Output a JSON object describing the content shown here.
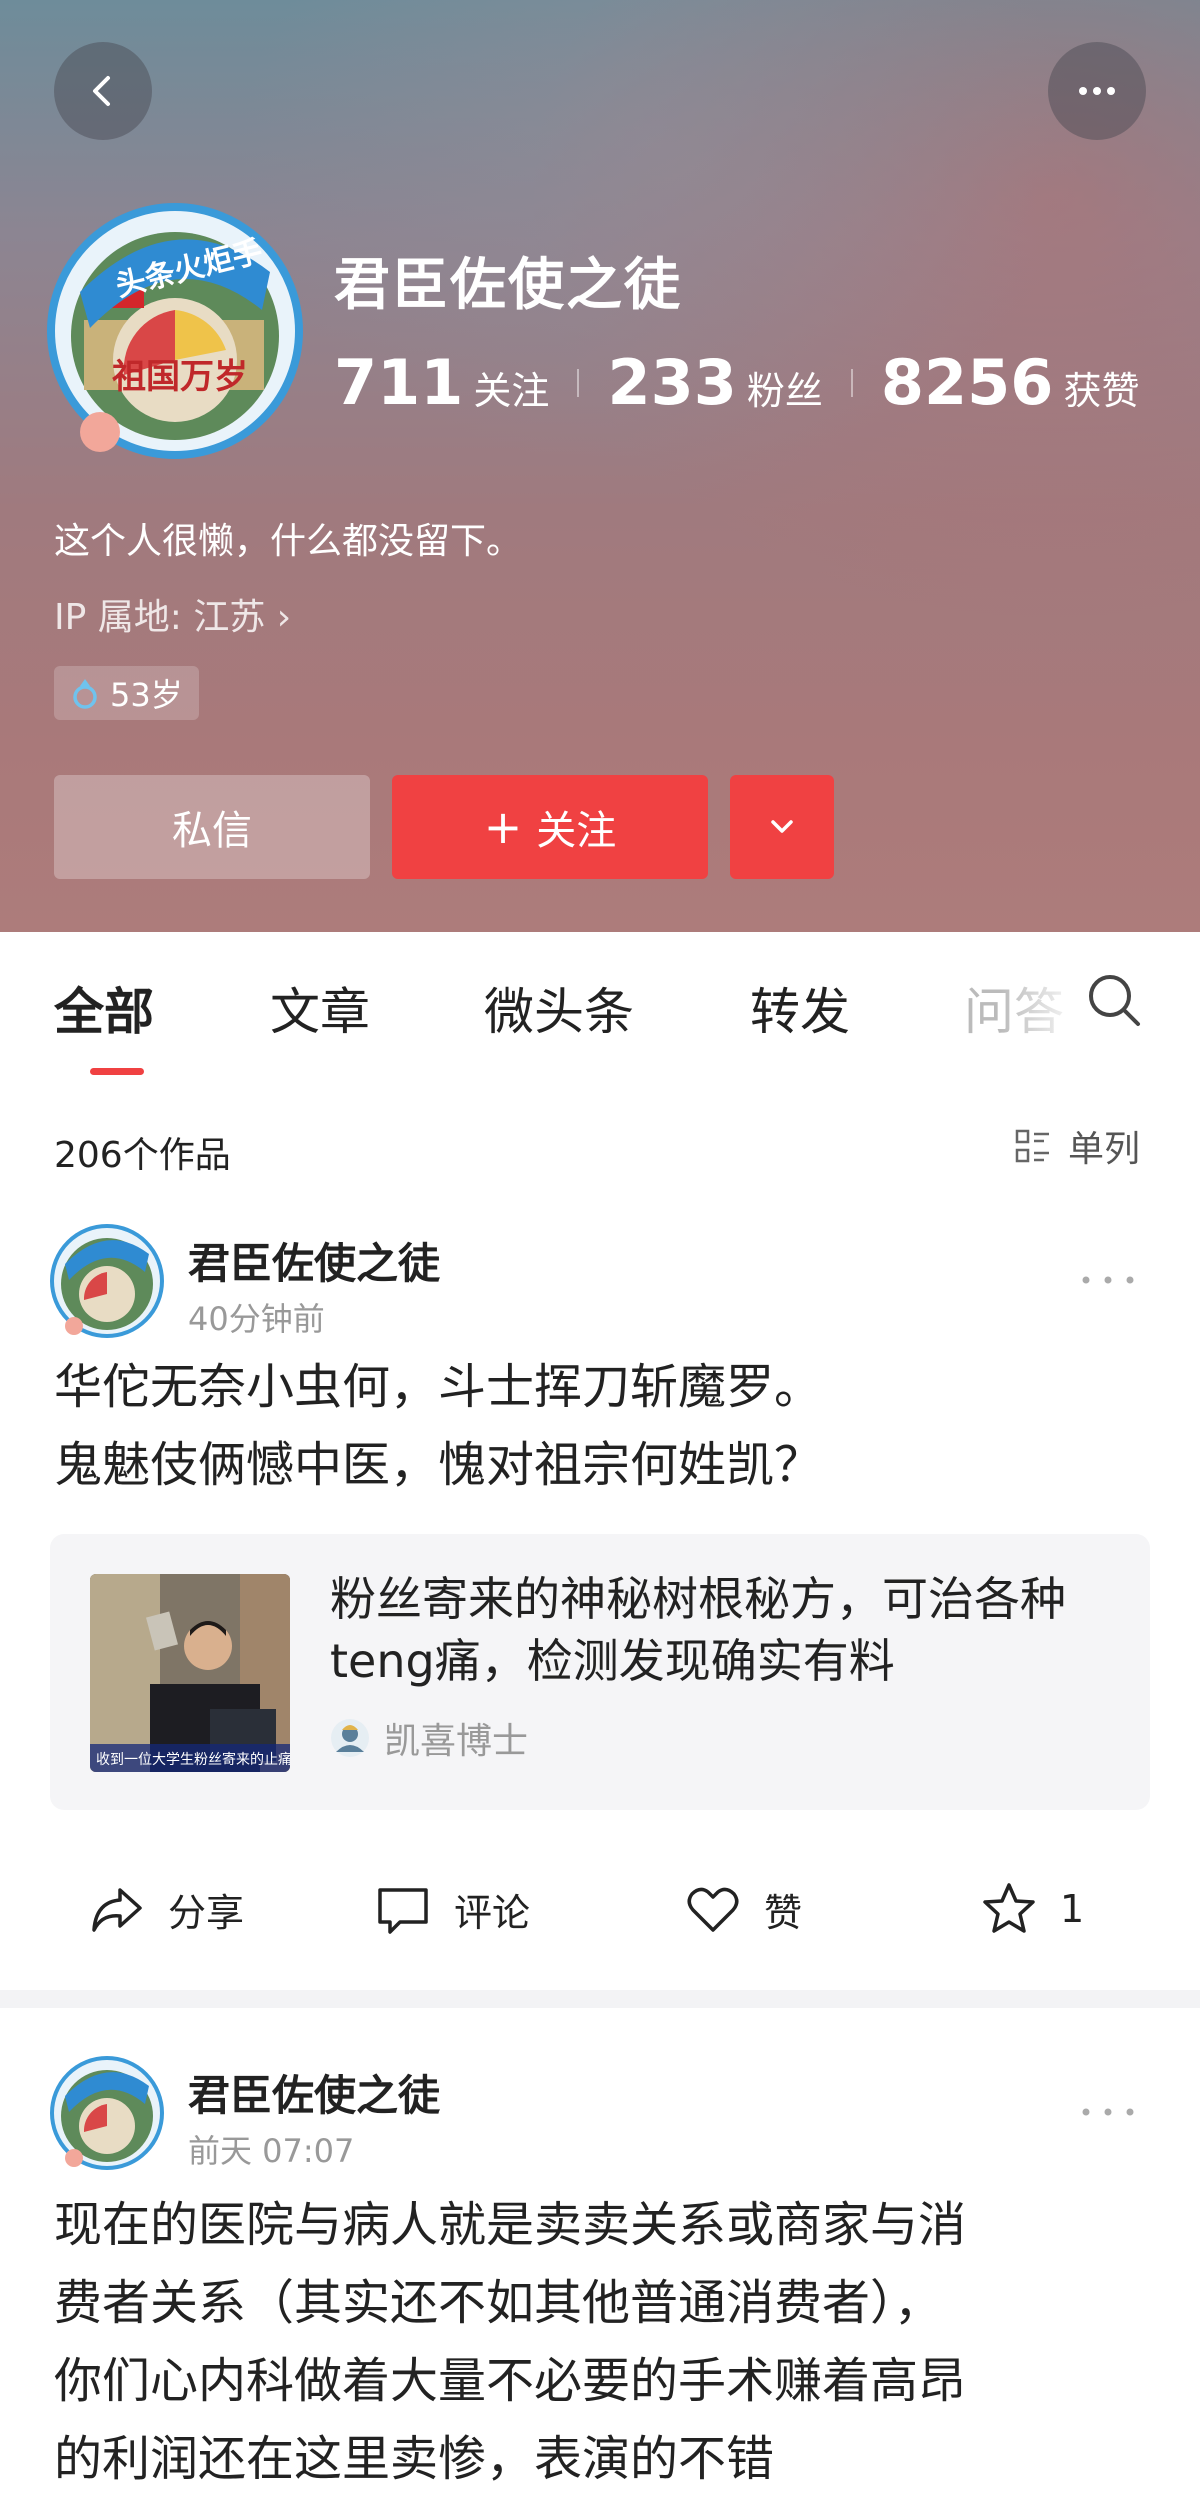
{
  "header": {
    "profile_name": "君臣佐使之徒",
    "avatar_badge": "头条火炬手",
    "avatar_text": "祖国万岁",
    "stats": [
      {
        "num": "711",
        "label": "关注"
      },
      {
        "num": "233",
        "label": "粉丝"
      },
      {
        "num": "8256",
        "label": "获赞"
      }
    ],
    "bio": "这个人很懒，什么都没留下。",
    "ip": "IP 属地: 江苏 ›",
    "age": "53岁",
    "message_label": "私信",
    "follow_label": "关注",
    "follow_accent": "#f04142"
  },
  "tabs": [
    "全部",
    "文章",
    "微头条",
    "转发",
    "问答"
  ],
  "works": {
    "count": "206个作品",
    "view_mode": "单列"
  },
  "posts": [
    {
      "author": "君臣佐使之徒",
      "time": "40分钟前",
      "text_line1": "华佗无奈小虫何，斗士挥刀斩魔罗。",
      "text_line2": "鬼魅伎俩憾中医，愧对祖宗何姓凯？",
      "card": {
        "title": "粉丝寄来的神秘树根秘方，可治各种teng痛，检测发现确实有料",
        "source": "凯喜博士",
        "thumb_caption": "收到一位大学生粉丝寄来的止痛"
      },
      "actions": {
        "share": "分享",
        "comment": "评论",
        "like": "赞",
        "favorite_count": "1"
      }
    },
    {
      "author": "君臣佐使之徒",
      "time": "前天  07:07",
      "lines": [
        "现在的医院与病人就是卖卖关系或商家与消",
        "费者关系（其实还不如其他普通消费者），",
        "你们心内科做着大量不必要的手术赚着高昂",
        "的利润还在这里卖惨，表演的不错"
      ]
    }
  ]
}
